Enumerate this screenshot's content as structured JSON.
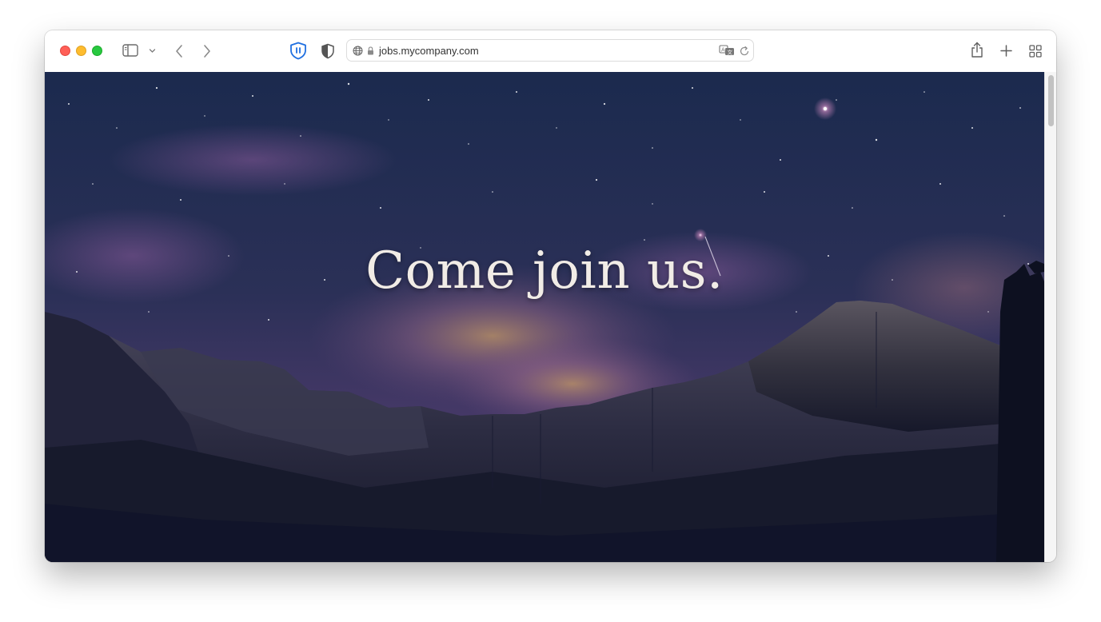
{
  "browser": {
    "address_bar": {
      "url": "jobs.mycompany.com"
    }
  },
  "icons": {
    "window_controls": [
      "close",
      "minimize",
      "zoom"
    ],
    "left_toolbar": [
      "sidebar-icon",
      "chevron-down-icon",
      "back-arrow-icon",
      "forward-arrow-icon"
    ],
    "extensions": [
      "bitwarden-shield-icon",
      "privacy-shield-icon"
    ],
    "address_bar": [
      "globe-icon",
      "lock-icon",
      "translate-icon",
      "reload-icon"
    ],
    "right_toolbar": [
      "share-icon",
      "new-tab-plus-icon",
      "tab-overview-icon"
    ]
  },
  "colors": {
    "close": "#ff5f57",
    "minimize": "#febc2e",
    "zoom": "#28c840",
    "accent_blue": "#1f6fe0",
    "sky_top": "#1b2a4e",
    "sky_mid": "#4a3a6a",
    "mountain_dark": "#141729"
  },
  "hero": {
    "title": "Come join us."
  }
}
